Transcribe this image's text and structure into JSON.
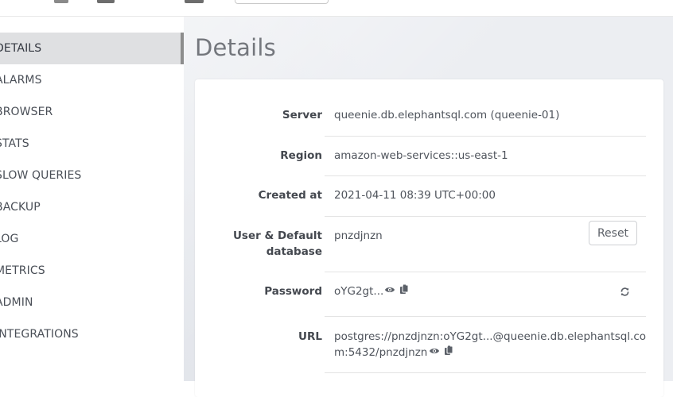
{
  "sidebar": {
    "items": [
      {
        "label": "DETAILS",
        "active": true
      },
      {
        "label": "ALARMS"
      },
      {
        "label": "BROWSER"
      },
      {
        "label": "STATS"
      },
      {
        "label": "SLOW QUERIES"
      },
      {
        "label": "BACKUP"
      },
      {
        "label": "LOG"
      },
      {
        "label": "METRICS"
      },
      {
        "label": "ADMIN"
      },
      {
        "label": "INTEGRATIONS"
      }
    ]
  },
  "main": {
    "title": "Details",
    "details": {
      "server": {
        "label": "Server",
        "value": "queenie.db.elephantsql.com (queenie-01)"
      },
      "region": {
        "label": "Region",
        "value": "amazon-web-services::us-east-1"
      },
      "created": {
        "label": "Created at",
        "value": "2021-04-11 08:39 UTC+00:00"
      },
      "user": {
        "label_line1": "User & Default",
        "label_line2": "database",
        "value": "pnzdjnzn",
        "reset_label": "Reset"
      },
      "password": {
        "label": "Password",
        "value": "oYG2gt..."
      },
      "url": {
        "label": "URL",
        "value_line1": "postgres://pnzdjnzn:oYG2gt...@queenie.db.elephantsql.co",
        "value_line2": "m:5432/pnzdjnzn"
      }
    }
  },
  "icons": {
    "show": "eye-icon",
    "copy": "clipboard-icon",
    "rotate": "refresh-icon"
  },
  "colors": {
    "active_nav_bg": "#dfe0e2",
    "active_nav_bar": "#8d8d8d",
    "main_bg": "#eceef2"
  }
}
